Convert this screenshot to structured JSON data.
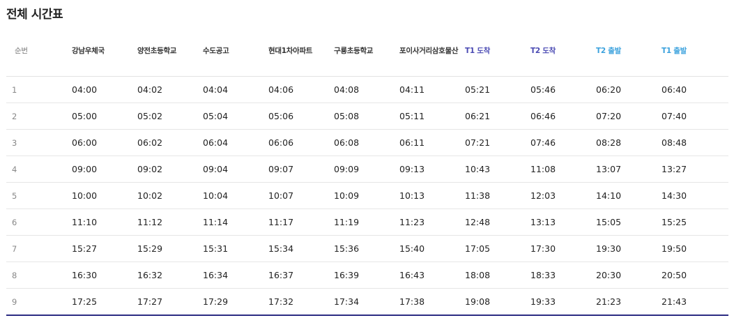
{
  "title": "전체 시간표",
  "columns": [
    {
      "label": "순번",
      "kind": "seq"
    },
    {
      "label": "강남우체국",
      "kind": "stop"
    },
    {
      "label": "양전초등학교",
      "kind": "stop"
    },
    {
      "label": "수도공고",
      "kind": "stop"
    },
    {
      "label": "현대1차아파트",
      "kind": "stop"
    },
    {
      "label": "구룡초등학교",
      "kind": "stop"
    },
    {
      "label": "포이사거리삼호물산",
      "kind": "stop"
    },
    {
      "label": "T1 도착",
      "kind": "arr"
    },
    {
      "label": "T2 도착",
      "kind": "arr"
    },
    {
      "label": "T2 출발",
      "kind": "dep"
    },
    {
      "label": "T1 출발",
      "kind": "dep"
    }
  ],
  "rows": [
    [
      "1",
      "04:00",
      "04:02",
      "04:04",
      "04:06",
      "04:08",
      "04:11",
      "05:21",
      "05:46",
      "06:20",
      "06:40"
    ],
    [
      "2",
      "05:00",
      "05:02",
      "05:04",
      "05:06",
      "05:08",
      "05:11",
      "06:21",
      "06:46",
      "07:20",
      "07:40"
    ],
    [
      "3",
      "06:00",
      "06:02",
      "06:04",
      "06:06",
      "06:08",
      "06:11",
      "07:21",
      "07:46",
      "08:28",
      "08:48"
    ],
    [
      "4",
      "09:00",
      "09:02",
      "09:04",
      "09:07",
      "09:09",
      "09:13",
      "10:43",
      "11:08",
      "13:07",
      "13:27"
    ],
    [
      "5",
      "10:00",
      "10:02",
      "10:04",
      "10:07",
      "10:09",
      "10:13",
      "11:38",
      "12:03",
      "14:10",
      "14:30"
    ],
    [
      "6",
      "11:10",
      "11:12",
      "11:14",
      "11:17",
      "11:19",
      "11:23",
      "12:48",
      "13:13",
      "15:05",
      "15:25"
    ],
    [
      "7",
      "15:27",
      "15:29",
      "15:31",
      "15:34",
      "15:36",
      "15:40",
      "17:05",
      "17:30",
      "19:30",
      "19:50"
    ],
    [
      "8",
      "16:30",
      "16:32",
      "16:34",
      "16:37",
      "16:39",
      "16:43",
      "18:08",
      "18:33",
      "20:30",
      "20:50"
    ],
    [
      "9",
      "17:25",
      "17:27",
      "17:29",
      "17:32",
      "17:34",
      "17:38",
      "19:08",
      "19:33",
      "21:23",
      "21:43"
    ]
  ],
  "colors": {
    "arrival_header": "#4a4ab3",
    "departure_header": "#3aa1dd",
    "bottom_rule": "#2b2b82"
  }
}
